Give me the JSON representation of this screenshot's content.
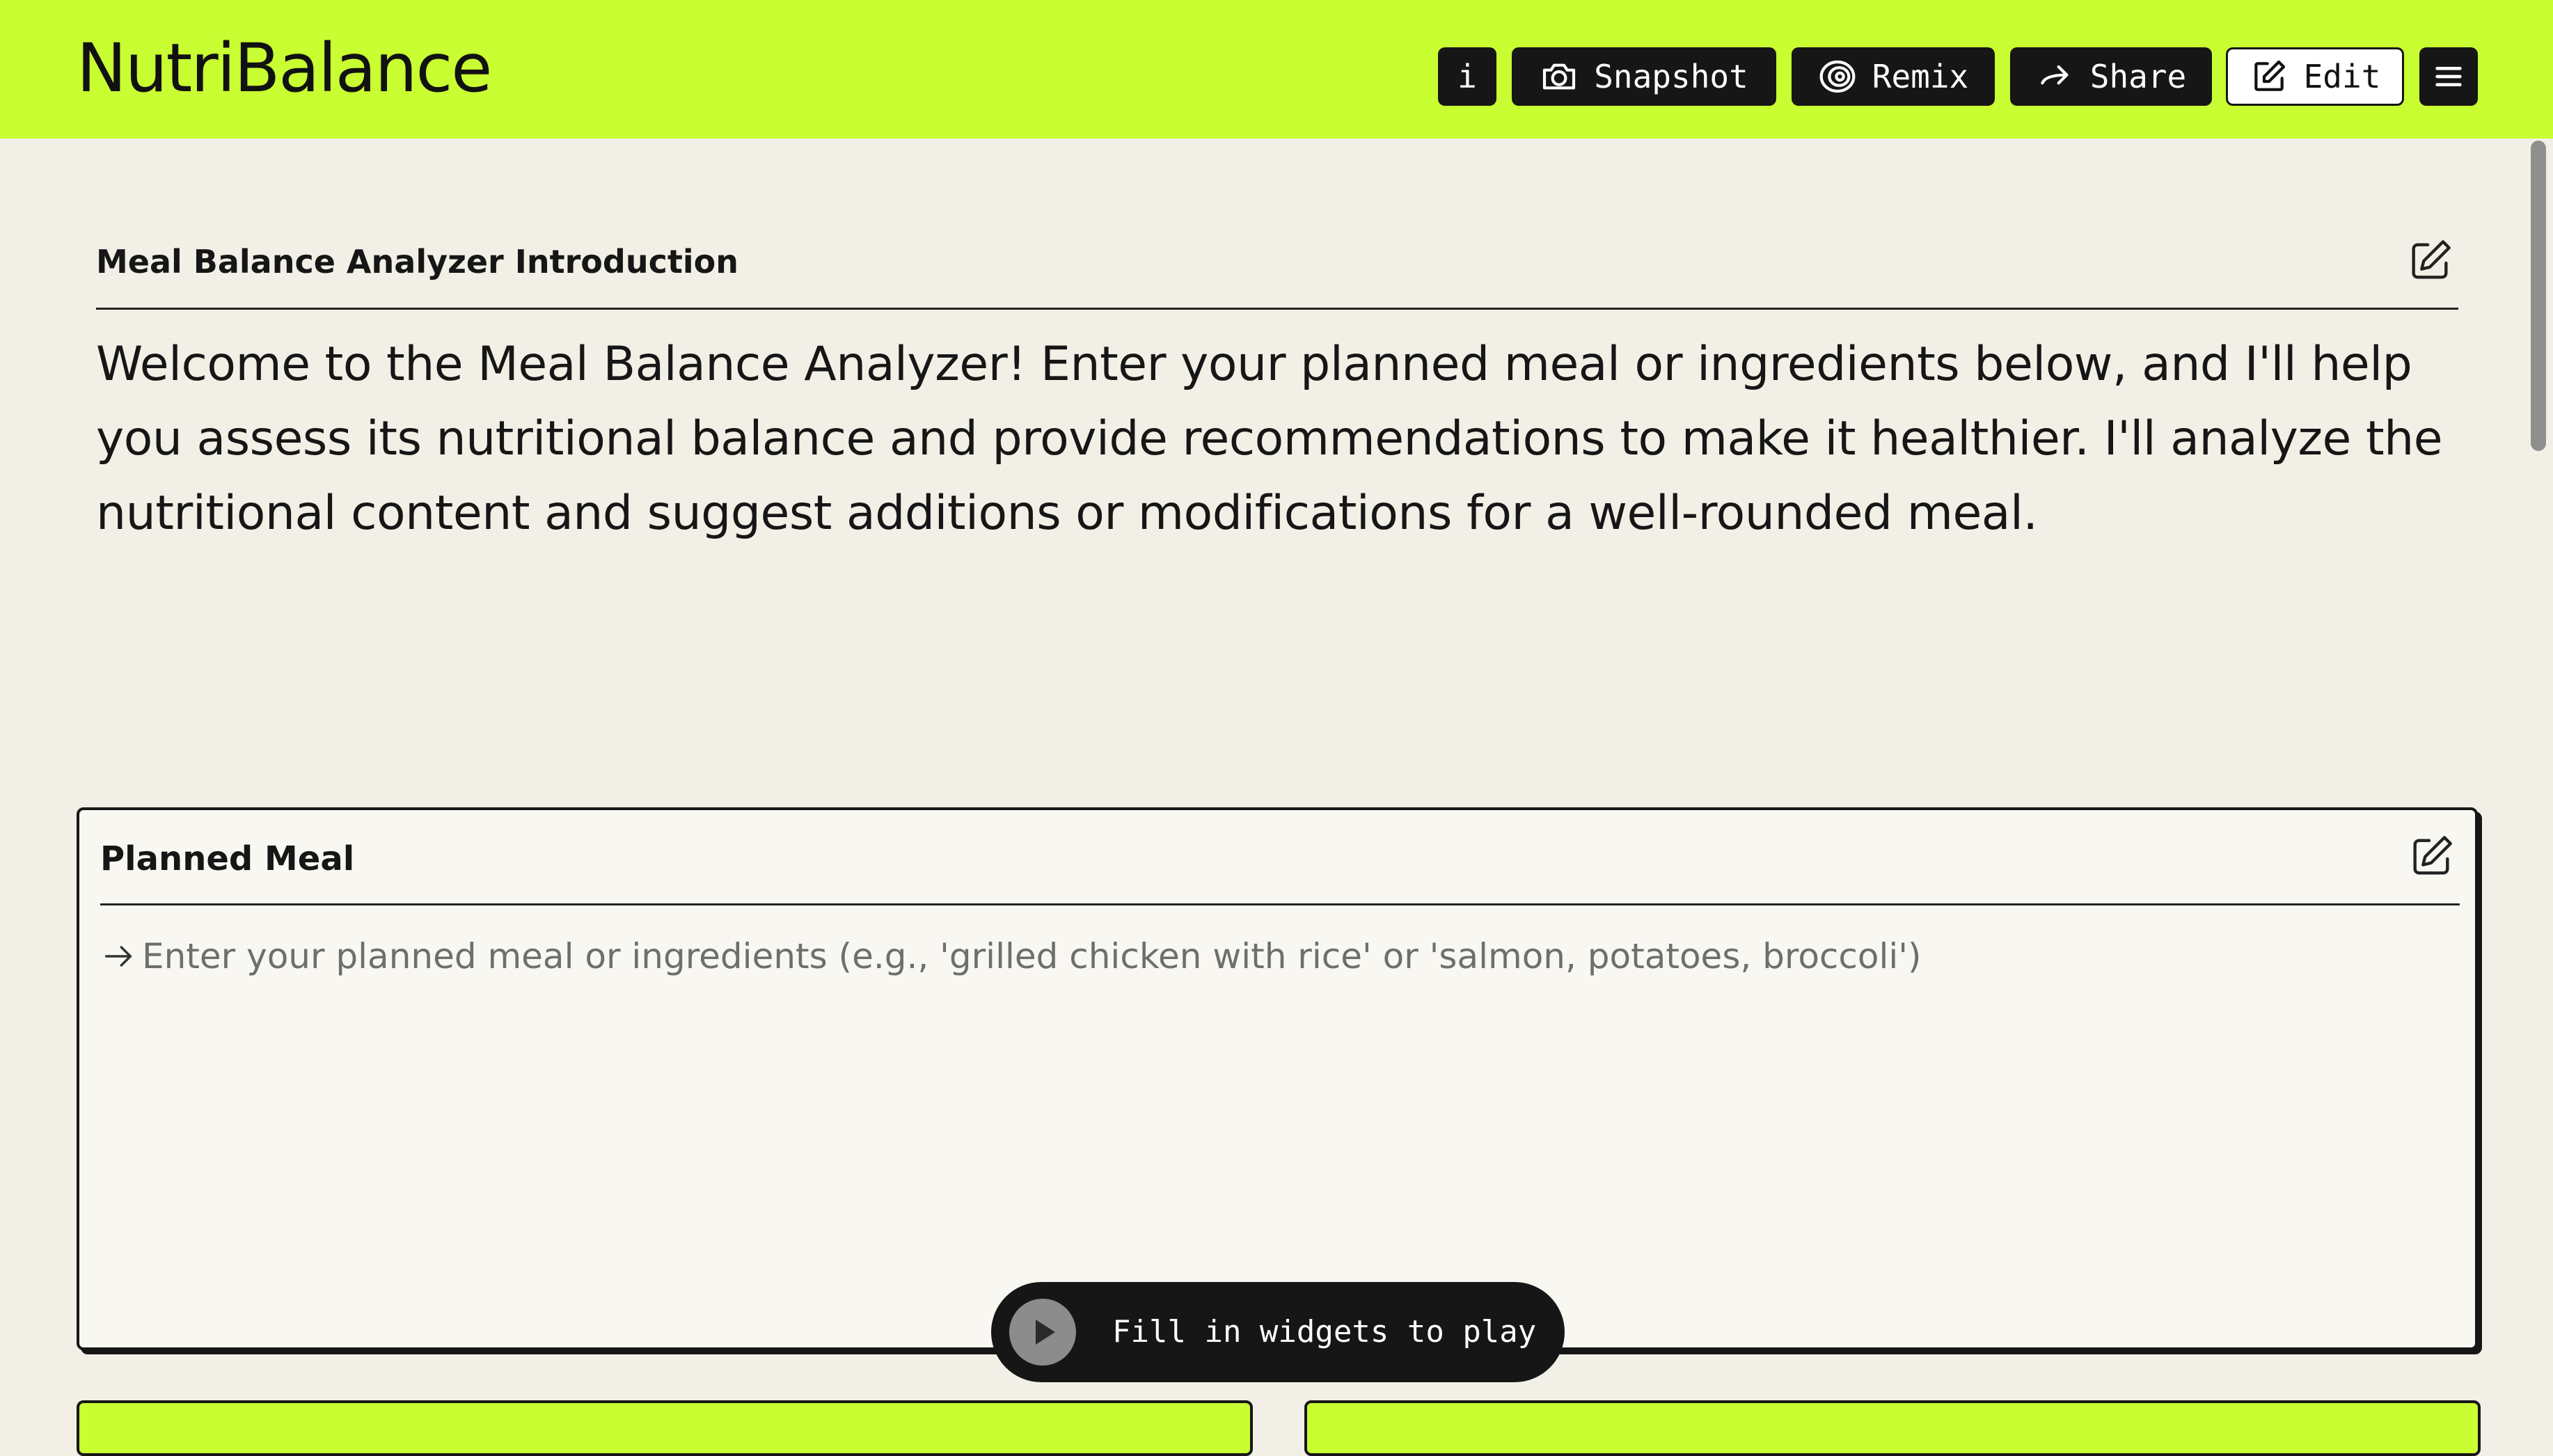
{
  "app": {
    "title": "NutriBalance"
  },
  "toolbar": {
    "info_label": "i",
    "snapshot_label": "Snapshot",
    "remix_label": "Remix",
    "share_label": "Share",
    "edit_label": "Edit",
    "icons": {
      "snapshot": "camera-icon",
      "remix": "remix-icon",
      "share": "arrow-right-icon",
      "edit": "pencil-square-icon",
      "menu": "hamburger-menu-icon"
    }
  },
  "intro": {
    "title": "Meal Balance Analyzer Introduction",
    "text": "Welcome to the Meal Balance Analyzer! Enter your planned meal or ingredients below, and I'll help you assess its nutritional balance and provide recommendations to make it healthier. I'll analyze the nutritional content and suggest additions or modifications for a well-rounded meal."
  },
  "planned_meal": {
    "title": "Planned Meal",
    "value": "",
    "placeholder": "Enter your planned meal or ingredients (e.g., 'grilled chicken with rice' or 'salmon, potatoes, broccoli')"
  },
  "play": {
    "label": "Fill in widgets to play"
  },
  "colors": {
    "accent": "#c8fe32",
    "background": "#f2f0e6",
    "card_background": "#f8f7f2",
    "dark": "#161616",
    "play_circle": "#8c8c8c"
  }
}
